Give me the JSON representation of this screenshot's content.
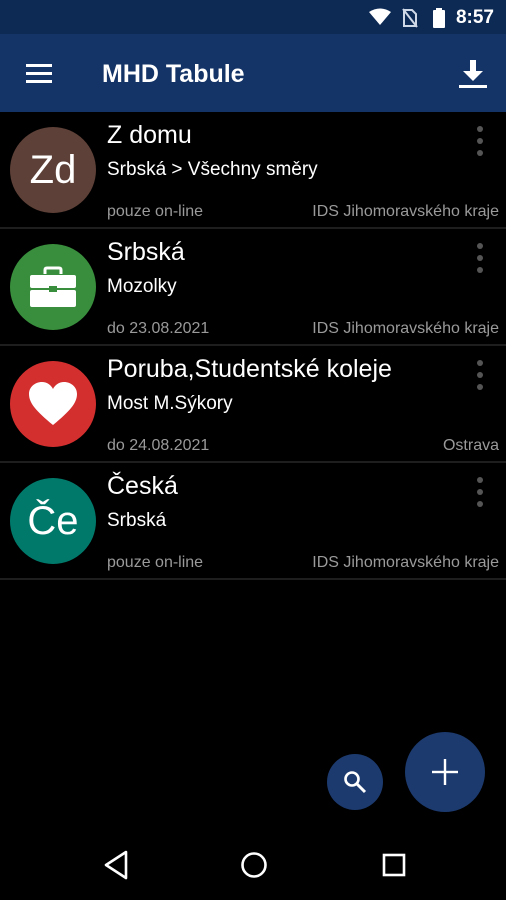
{
  "status_bar": {
    "time": "8:57",
    "icons": [
      "wifi-icon",
      "no-sim-icon",
      "battery-icon"
    ]
  },
  "app_bar": {
    "title": "MHD Tabule",
    "menu_icon": "hamburger-menu-icon",
    "action_icon": "download-icon",
    "background": "#143366"
  },
  "boards": [
    {
      "avatar_text": "Zd",
      "avatar_color": "#5d4037",
      "name": "Z domu",
      "route": "Srbská > Všechny směry",
      "validity": "pouze on-line",
      "region": "IDS Jihomoravského kraje"
    },
    {
      "avatar_icon": "briefcase-icon",
      "avatar_color": "#388e3c",
      "name": "Srbská",
      "route": "Mozolky",
      "validity": "do 23.08.2021",
      "region": "IDS Jihomoravského kraje"
    },
    {
      "avatar_icon": "heart-icon",
      "avatar_color": "#d32f2f",
      "name": "Poruba,Studentské koleje",
      "route": "Most M.Sýkory",
      "validity": "do 24.08.2021",
      "region": "Ostrava"
    },
    {
      "avatar_text": "Če",
      "avatar_color": "#00796b",
      "name": "Česká",
      "route": "Srbská",
      "validity": "pouze on-line",
      "region": "IDS Jihomoravského kraje"
    }
  ],
  "fab": {
    "search_icon": "search-icon",
    "add_icon": "plus-icon",
    "color": "#1c3a6e"
  },
  "nav_bar": {
    "icons": [
      "back-icon",
      "home-icon",
      "recents-icon"
    ]
  }
}
